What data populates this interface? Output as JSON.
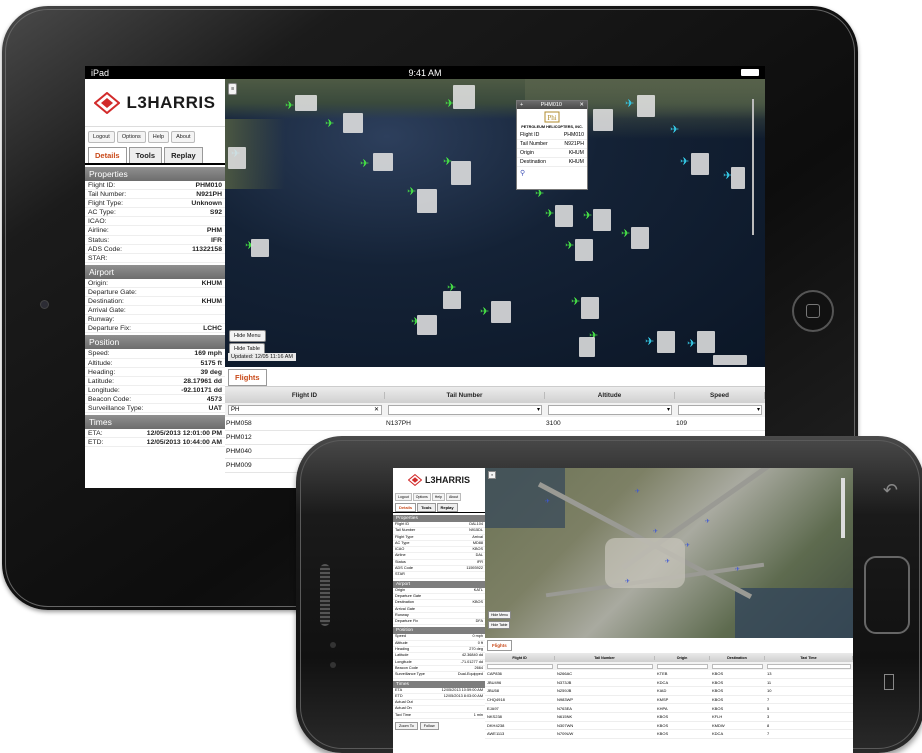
{
  "ipad": {
    "status": {
      "carrier": "iPad",
      "time": "9:41 AM"
    },
    "brand": "L3HARRIS",
    "menu": [
      "Logout",
      "Options",
      "Help",
      "About"
    ],
    "tabs": [
      "Details",
      "Tools",
      "Replay"
    ],
    "sections": {
      "properties": "Properties",
      "airport": "Airport",
      "position": "Position",
      "times": "Times"
    },
    "properties": [
      {
        "k": "Flight ID:",
        "v": "PHM010"
      },
      {
        "k": "Tail Number:",
        "v": "N921PH"
      },
      {
        "k": "Flight Type:",
        "v": "Unknown"
      },
      {
        "k": "AC Type:",
        "v": "S92"
      },
      {
        "k": "ICAO:",
        "v": ""
      },
      {
        "k": "Airline:",
        "v": "PHM"
      },
      {
        "k": "Status:",
        "v": "IFR"
      },
      {
        "k": "ADS Code:",
        "v": "11322158"
      },
      {
        "k": "STAR:",
        "v": ""
      }
    ],
    "airport": [
      {
        "k": "Origin:",
        "v": "KHUM"
      },
      {
        "k": "Departure Gate:",
        "v": ""
      },
      {
        "k": "Destination:",
        "v": "KHUM"
      },
      {
        "k": "Arrival Gate:",
        "v": ""
      },
      {
        "k": "Runway:",
        "v": ""
      },
      {
        "k": "Departure Fix:",
        "v": "LCHC"
      }
    ],
    "position": [
      {
        "k": "Speed:",
        "v": "169 mph"
      },
      {
        "k": "Altitude:",
        "v": "5175 ft"
      },
      {
        "k": "Heading:",
        "v": "39 deg"
      },
      {
        "k": "Latitude:",
        "v": "28.17961 dd"
      },
      {
        "k": "Longitude:",
        "v": "-92.10171 dd"
      },
      {
        "k": "Beacon Code:",
        "v": "4573"
      },
      {
        "k": "Surveillance Type:",
        "v": "UAT"
      }
    ],
    "times": [
      {
        "k": "ETA:",
        "v": "12/05/2013 12:01:00 PM"
      },
      {
        "k": "ETD:",
        "v": "12/05/2013 10:44:00 AM"
      }
    ],
    "map": {
      "popup": {
        "title": "PHM010",
        "company": "PETROLEUM HELICOPTERS, INC.",
        "rows": [
          {
            "k": "Flight ID",
            "v": "PHM010"
          },
          {
            "k": "Tail Number",
            "v": "N921PH"
          },
          {
            "k": "Origin",
            "v": "KHUM"
          },
          {
            "k": "Destination",
            "v": "KHUM"
          }
        ]
      },
      "hide_menu": "Hide Menu",
      "hide_table": "Hide Table",
      "updated": "Updated: 12/05 11:16 AM"
    },
    "table": {
      "tab": "Flights",
      "columns": [
        "Flight ID",
        "Tail Number",
        "Altitude",
        "Speed"
      ],
      "filter_value": "PH",
      "rows": [
        [
          "PHM058",
          "N137PH",
          "3100",
          "109"
        ],
        [
          "PHM012",
          "",
          "",
          ""
        ],
        [
          "PHM040",
          "",
          "",
          ""
        ],
        [
          "PHM009",
          "",
          "",
          ""
        ]
      ]
    }
  },
  "phone": {
    "brand": "L3HARRIS",
    "menu": [
      "Logout",
      "Options",
      "Help",
      "About"
    ],
    "tabs": [
      "Details",
      "Tools",
      "Replay"
    ],
    "sections": {
      "properties": "Properties",
      "airport": "Airport",
      "position": "Position",
      "times": "Times"
    },
    "properties": [
      {
        "k": "Flight ID",
        "v": "DAL104"
      },
      {
        "k": "Tail Number",
        "v": "N915DL"
      },
      {
        "k": "Flight Type",
        "v": "Arrival"
      },
      {
        "k": "AC Type",
        "v": "MD88"
      },
      {
        "k": "ICAO",
        "v": "KBOS"
      },
      {
        "k": "Airline",
        "v": "DAL"
      },
      {
        "k": "Status",
        "v": "IFR"
      },
      {
        "k": "ADS Code",
        "v": "11593922"
      },
      {
        "k": "STAR",
        "v": ""
      }
    ],
    "airport": [
      {
        "k": "Origin",
        "v": "KATL"
      },
      {
        "k": "Departure Gate",
        "v": ""
      },
      {
        "k": "Destination",
        "v": "KBOS"
      },
      {
        "k": "Arrival Gate",
        "v": ""
      },
      {
        "k": "Runway",
        "v": ""
      },
      {
        "k": "Departure Fix",
        "v": "DFA"
      }
    ],
    "position": [
      {
        "k": "Speed",
        "v": "0 mph"
      },
      {
        "k": "Altitude",
        "v": "0 ft"
      },
      {
        "k": "Heading",
        "v": "270 deg"
      },
      {
        "k": "Latitude",
        "v": "42.36840 dd"
      },
      {
        "k": "Longitude",
        "v": "-71.01277 dd"
      },
      {
        "k": "Beacon Code",
        "v": "2664"
      },
      {
        "k": "Surveillance Type",
        "v": "Dual-Equipped"
      }
    ],
    "times": [
      {
        "k": "ETA",
        "v": "12/05/2013 10:59:00 AM"
      },
      {
        "k": "ETD",
        "v": "12/05/2013 8:03:00 AM"
      },
      {
        "k": "Actual Out",
        "v": ""
      },
      {
        "k": "Actual On",
        "v": ""
      },
      {
        "k": "Taxi Time",
        "v": "1 min"
      }
    ],
    "buttons": [
      "Zoom To",
      "Follow"
    ],
    "hide_menu": "Hide Menu",
    "hide_table": "Hide Table",
    "table": {
      "tab": "Flights",
      "columns": [
        "Flight ID",
        "Tail Number",
        "Origin",
        "Destination",
        "Taxi Time"
      ],
      "rows": [
        [
          "CAP836",
          "N266AC",
          "KTEB",
          "KBOS",
          "13"
        ],
        [
          "JBU496",
          "N373JB",
          "KDCA",
          "KBOS",
          "11"
        ],
        [
          "JBU58",
          "N259JB",
          "KIAD",
          "KBOS",
          "10"
        ],
        [
          "CHQ4918",
          "N983WP",
          "KMSP",
          "KBOS",
          "7"
        ],
        [
          "EJA97",
          "N763EA",
          "KHPA",
          "KBOS",
          "5"
        ],
        [
          "NKS238",
          "N615NK",
          "KBOS",
          "KFLH",
          "3"
        ],
        [
          "DKH4238",
          "N307WN",
          "KBOS",
          "KMDW",
          "8"
        ],
        [
          "AWE1113",
          "N709UW",
          "KBOS",
          "KDCA",
          "7"
        ]
      ]
    }
  }
}
